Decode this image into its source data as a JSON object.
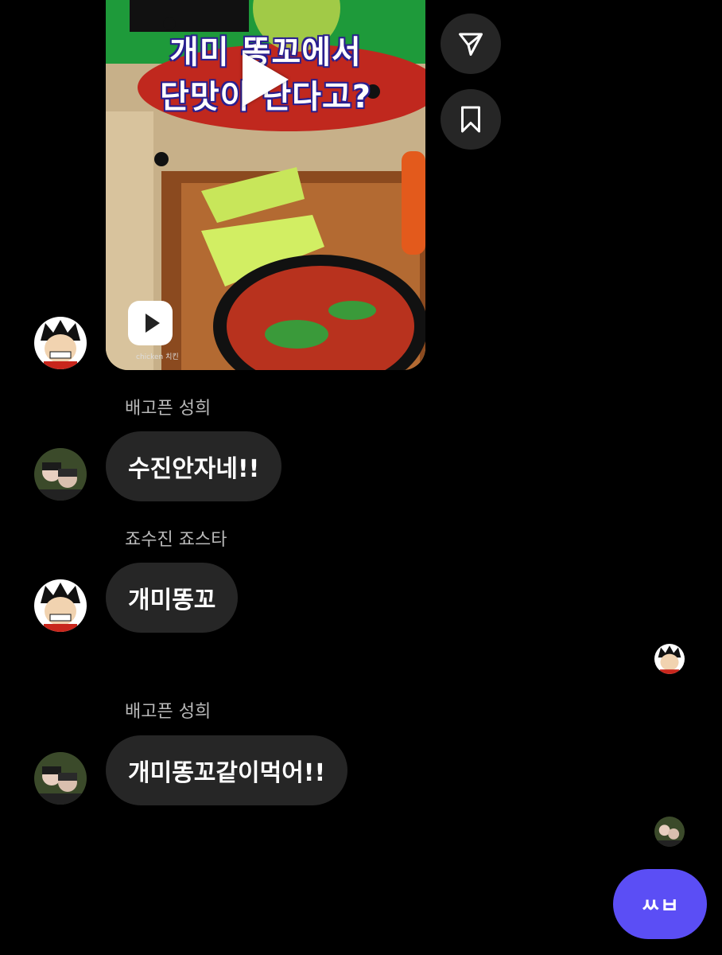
{
  "video": {
    "title": "개미 똥꼬에서\n단맛이 난다고?",
    "caption": "chicken 치킨"
  },
  "actions": {
    "share_icon": "paper-plane-icon",
    "save_icon": "bookmark-icon"
  },
  "messages": [
    {
      "sender": "배고픈 성희",
      "text": "수진안자네!!"
    },
    {
      "sender": "죠수진 죠스타",
      "text": "개미똥꼬"
    },
    {
      "sender": "배고픈 성희",
      "text": "개미똥꼬같이먹어!!"
    }
  ],
  "fab": {
    "label": "ㅆㅂ"
  },
  "colors": {
    "bubble": "#262626",
    "accent": "#5b4ef5",
    "background": "#000000"
  }
}
